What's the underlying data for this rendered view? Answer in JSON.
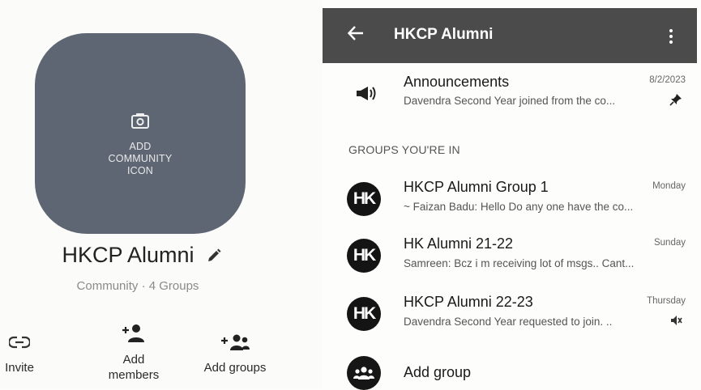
{
  "left": {
    "icon_label_lines": [
      "ADD",
      "COMMUNITY",
      "ICON"
    ],
    "community_name": "HKCP Alumni",
    "community_subtitle": "Community · 4 Groups",
    "actions": {
      "invite": "Invite",
      "add_members": [
        "Add",
        "members"
      ],
      "add_groups": "Add groups"
    },
    "icons": [
      "camera-icon",
      "pencil-icon",
      "link-icon",
      "person-add-icon",
      "group-add-icon"
    ]
  },
  "right": {
    "header": {
      "title": "HKCP Alumni",
      "icons": [
        "back-arrow-icon",
        "kebab-menu-icon"
      ]
    },
    "announcements": {
      "title": "Announcements",
      "date": "8/2/2023",
      "preview": "Davendra Second Year joined from the co...",
      "icons": [
        "megaphone-icon",
        "pin-icon"
      ]
    },
    "section_label": "GROUPS YOU'RE IN",
    "groups": [
      {
        "avatar": "HK",
        "name": "HKCP Alumni Group 1",
        "time": "Monday",
        "preview": "~ Faizan Badu: Hello Do any one have the co..."
      },
      {
        "avatar": "HK",
        "name": "HK Alumni 21-22",
        "time": "Sunday",
        "preview": "Samreen: Bcz i m receiving lot of msgs.. Cant..."
      },
      {
        "avatar": "HK",
        "name": "HKCP Alumni  22-23",
        "time": "Thursday",
        "preview": "Davendra Second Year requested to join. ..",
        "muted": true
      }
    ],
    "add_group": {
      "label": "Add group",
      "icon": "add-group-icon"
    }
  },
  "colors": {
    "header_bg": "#4b4b4b",
    "icon_tile_bg": "#5f6673",
    "avatar_bg": "#141414"
  }
}
